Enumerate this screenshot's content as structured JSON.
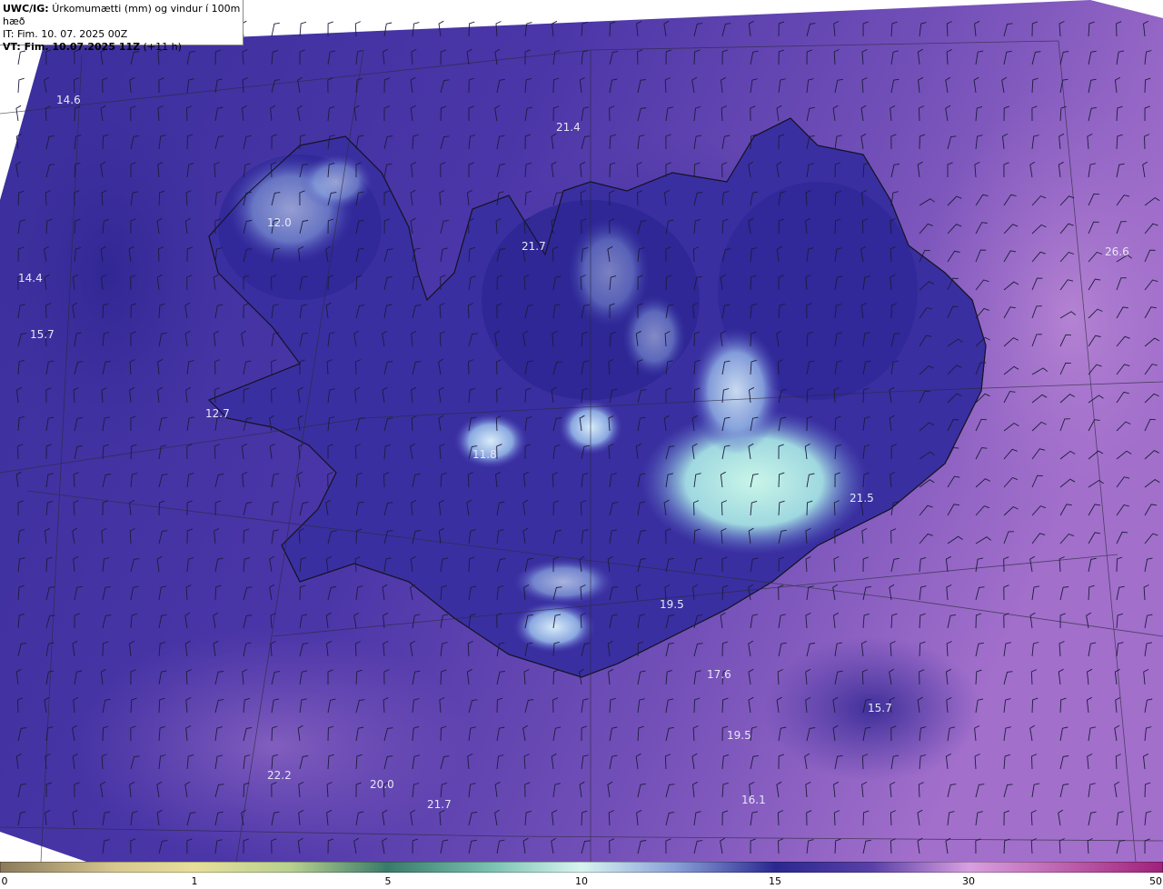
{
  "header": {
    "product": "UWC/IG:",
    "title": "Úrkomumætti (mm) og vindur í 100m hæð",
    "issue_line": "IT: Fim. 10. 07. 2025 00Z",
    "valid_prefix": "VT: Fim. 10.07.2025 11Z",
    "valid_suffix": " (+11 h)"
  },
  "colors": {
    "ocean_deep": "#3d2d9a",
    "ocean_violet": "#6a4ab5",
    "ocean_east": "#9b6ac8",
    "land_dark": "#2a2390",
    "land_high": "#b8f0e0",
    "coast": "#1a1a2a",
    "barb": "#1c1c3c"
  },
  "value_labels": [
    {
      "text": "14.6"
    },
    {
      "text": "21.4"
    },
    {
      "text": "12.0"
    },
    {
      "text": "21.7"
    },
    {
      "text": "26.6"
    },
    {
      "text": "14.4"
    },
    {
      "text": "15.7"
    },
    {
      "text": "12.7"
    },
    {
      "text": "11.8"
    },
    {
      "text": "21.5"
    },
    {
      "text": "19.5"
    },
    {
      "text": "17.6"
    },
    {
      "text": "15.7"
    },
    {
      "text": "19.5"
    },
    {
      "text": "22.2"
    },
    {
      "text": "20.0"
    },
    {
      "text": "21.7"
    },
    {
      "text": "16.1"
    }
  ],
  "colorbar": {
    "ticks": [
      "0",
      "1",
      "5",
      "10",
      "15",
      "30",
      "50"
    ]
  }
}
